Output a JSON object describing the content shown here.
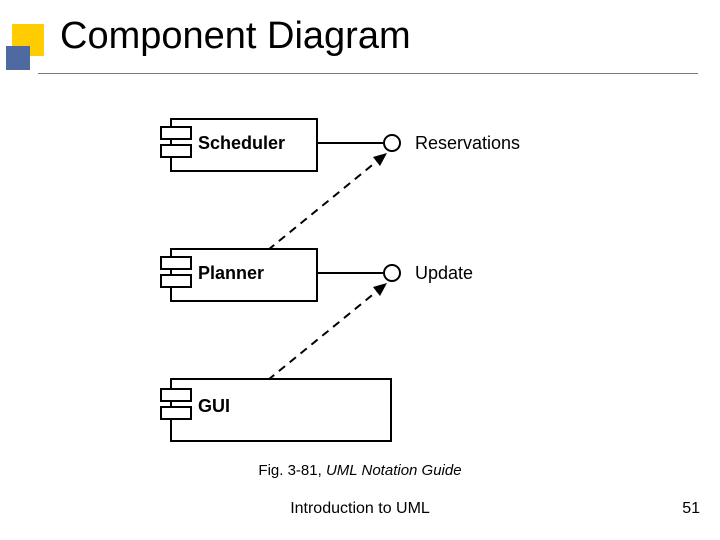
{
  "title": "Component Diagram",
  "components": {
    "scheduler": {
      "label": "Scheduler"
    },
    "planner": {
      "label": "Planner"
    },
    "gui": {
      "label": "GUI"
    }
  },
  "interfaces": {
    "reservations": {
      "label": "Reservations"
    },
    "update": {
      "label": "Update"
    }
  },
  "caption": {
    "prefix": "Fig. 3-81, ",
    "italic": "UML Notation Guide"
  },
  "footer": "Introduction to UML",
  "page_number": "51",
  "colors": {
    "accent_yellow": "#ffcc00",
    "accent_blue": "#4e6aa0"
  }
}
